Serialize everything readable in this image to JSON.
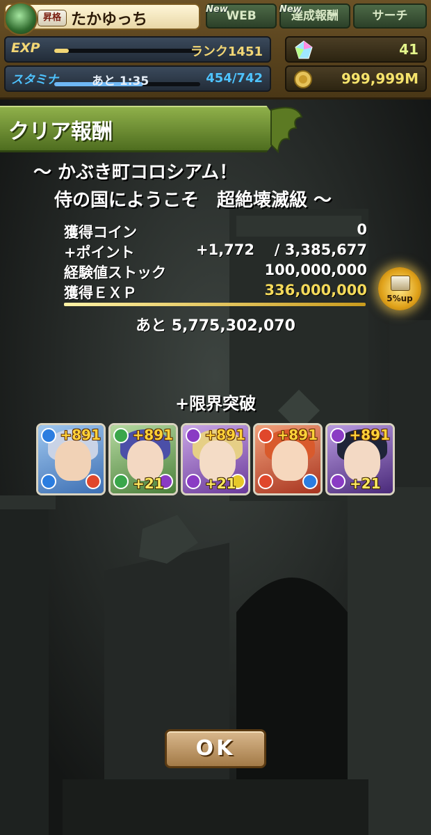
{
  "header": {
    "rank_badge": "昇格",
    "player_name": "たかゆっち",
    "web_tab": {
      "label": "WEB",
      "new_tag": "New"
    },
    "achievement_tab": {
      "label": "達成報酬",
      "new_tag": "New"
    },
    "search_tab": {
      "label": "サーチ"
    },
    "exp_label": "EXP",
    "rank_text": "ランク1451",
    "exp_progress": 0.1,
    "stamina_label": "スタミナ",
    "stamina_timer": "あと 1:35",
    "stamina_value": "454/742",
    "stamina_progress": 0.61,
    "magic_stones": "41",
    "coins": "999,999M"
  },
  "banner": {
    "title": "クリア報酬"
  },
  "dungeon": {
    "line1": "～ かぶき町コロシアム！",
    "line2": "侍の国にようこそ　超絶壊滅級 ～"
  },
  "rewards": {
    "coin_label": "獲得コイン",
    "coin_value": "0",
    "points_label": "+ポイント",
    "points_gained": "+1,772",
    "points_total": "/ 3,385,677",
    "stock_label": "経験値ストック",
    "stock_value": "100,000,000",
    "exp_label": "獲得ＥＸＰ",
    "exp_value": "336,000,000",
    "bonus_label": "5%up",
    "remaining": "あと 5,775,302,070"
  },
  "limit_break": {
    "title": "+限界突破"
  },
  "monsters": [
    {
      "plus": "+891",
      "bonus": "",
      "attr": "water"
    },
    {
      "plus": "+891",
      "bonus": "+21",
      "attr": "wood"
    },
    {
      "plus": "+891",
      "bonus": "+21",
      "attr": "dark"
    },
    {
      "plus": "+891",
      "bonus": "",
      "attr": "fire"
    },
    {
      "plus": "+891",
      "bonus": "+21",
      "attr": "dark"
    }
  ],
  "ok_button": {
    "label": "OK"
  },
  "colors": {
    "exp_bar": "#f2d675",
    "stamina_bar": "#6fb8f5",
    "stamina_text": "#4ec3ff",
    "gold": "#f5e36b",
    "banner_green": "#7a9a3b"
  }
}
